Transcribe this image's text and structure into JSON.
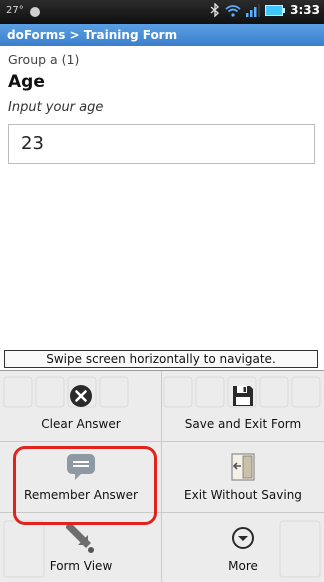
{
  "status": {
    "temperature": "27°",
    "time": "3:33"
  },
  "app": {
    "breadcrumb": "doForms > Training Form"
  },
  "form": {
    "group_label": "Group a (1)",
    "question_title": "Age",
    "question_hint": "Input your age",
    "answer_value": "23"
  },
  "swipe_hint": "Swipe screen horizontally to navigate.",
  "menu": {
    "clear_answer": "Clear Answer",
    "save_exit": "Save and Exit Form",
    "remember_answer": "Remember Answer",
    "exit_without_saving": "Exit Without Saving",
    "form_view": "Form View",
    "more": "More"
  },
  "colors": {
    "title_bar": "#4a8fd8",
    "highlight": "#e0231e",
    "remember_icon": "#8d9aa3"
  }
}
